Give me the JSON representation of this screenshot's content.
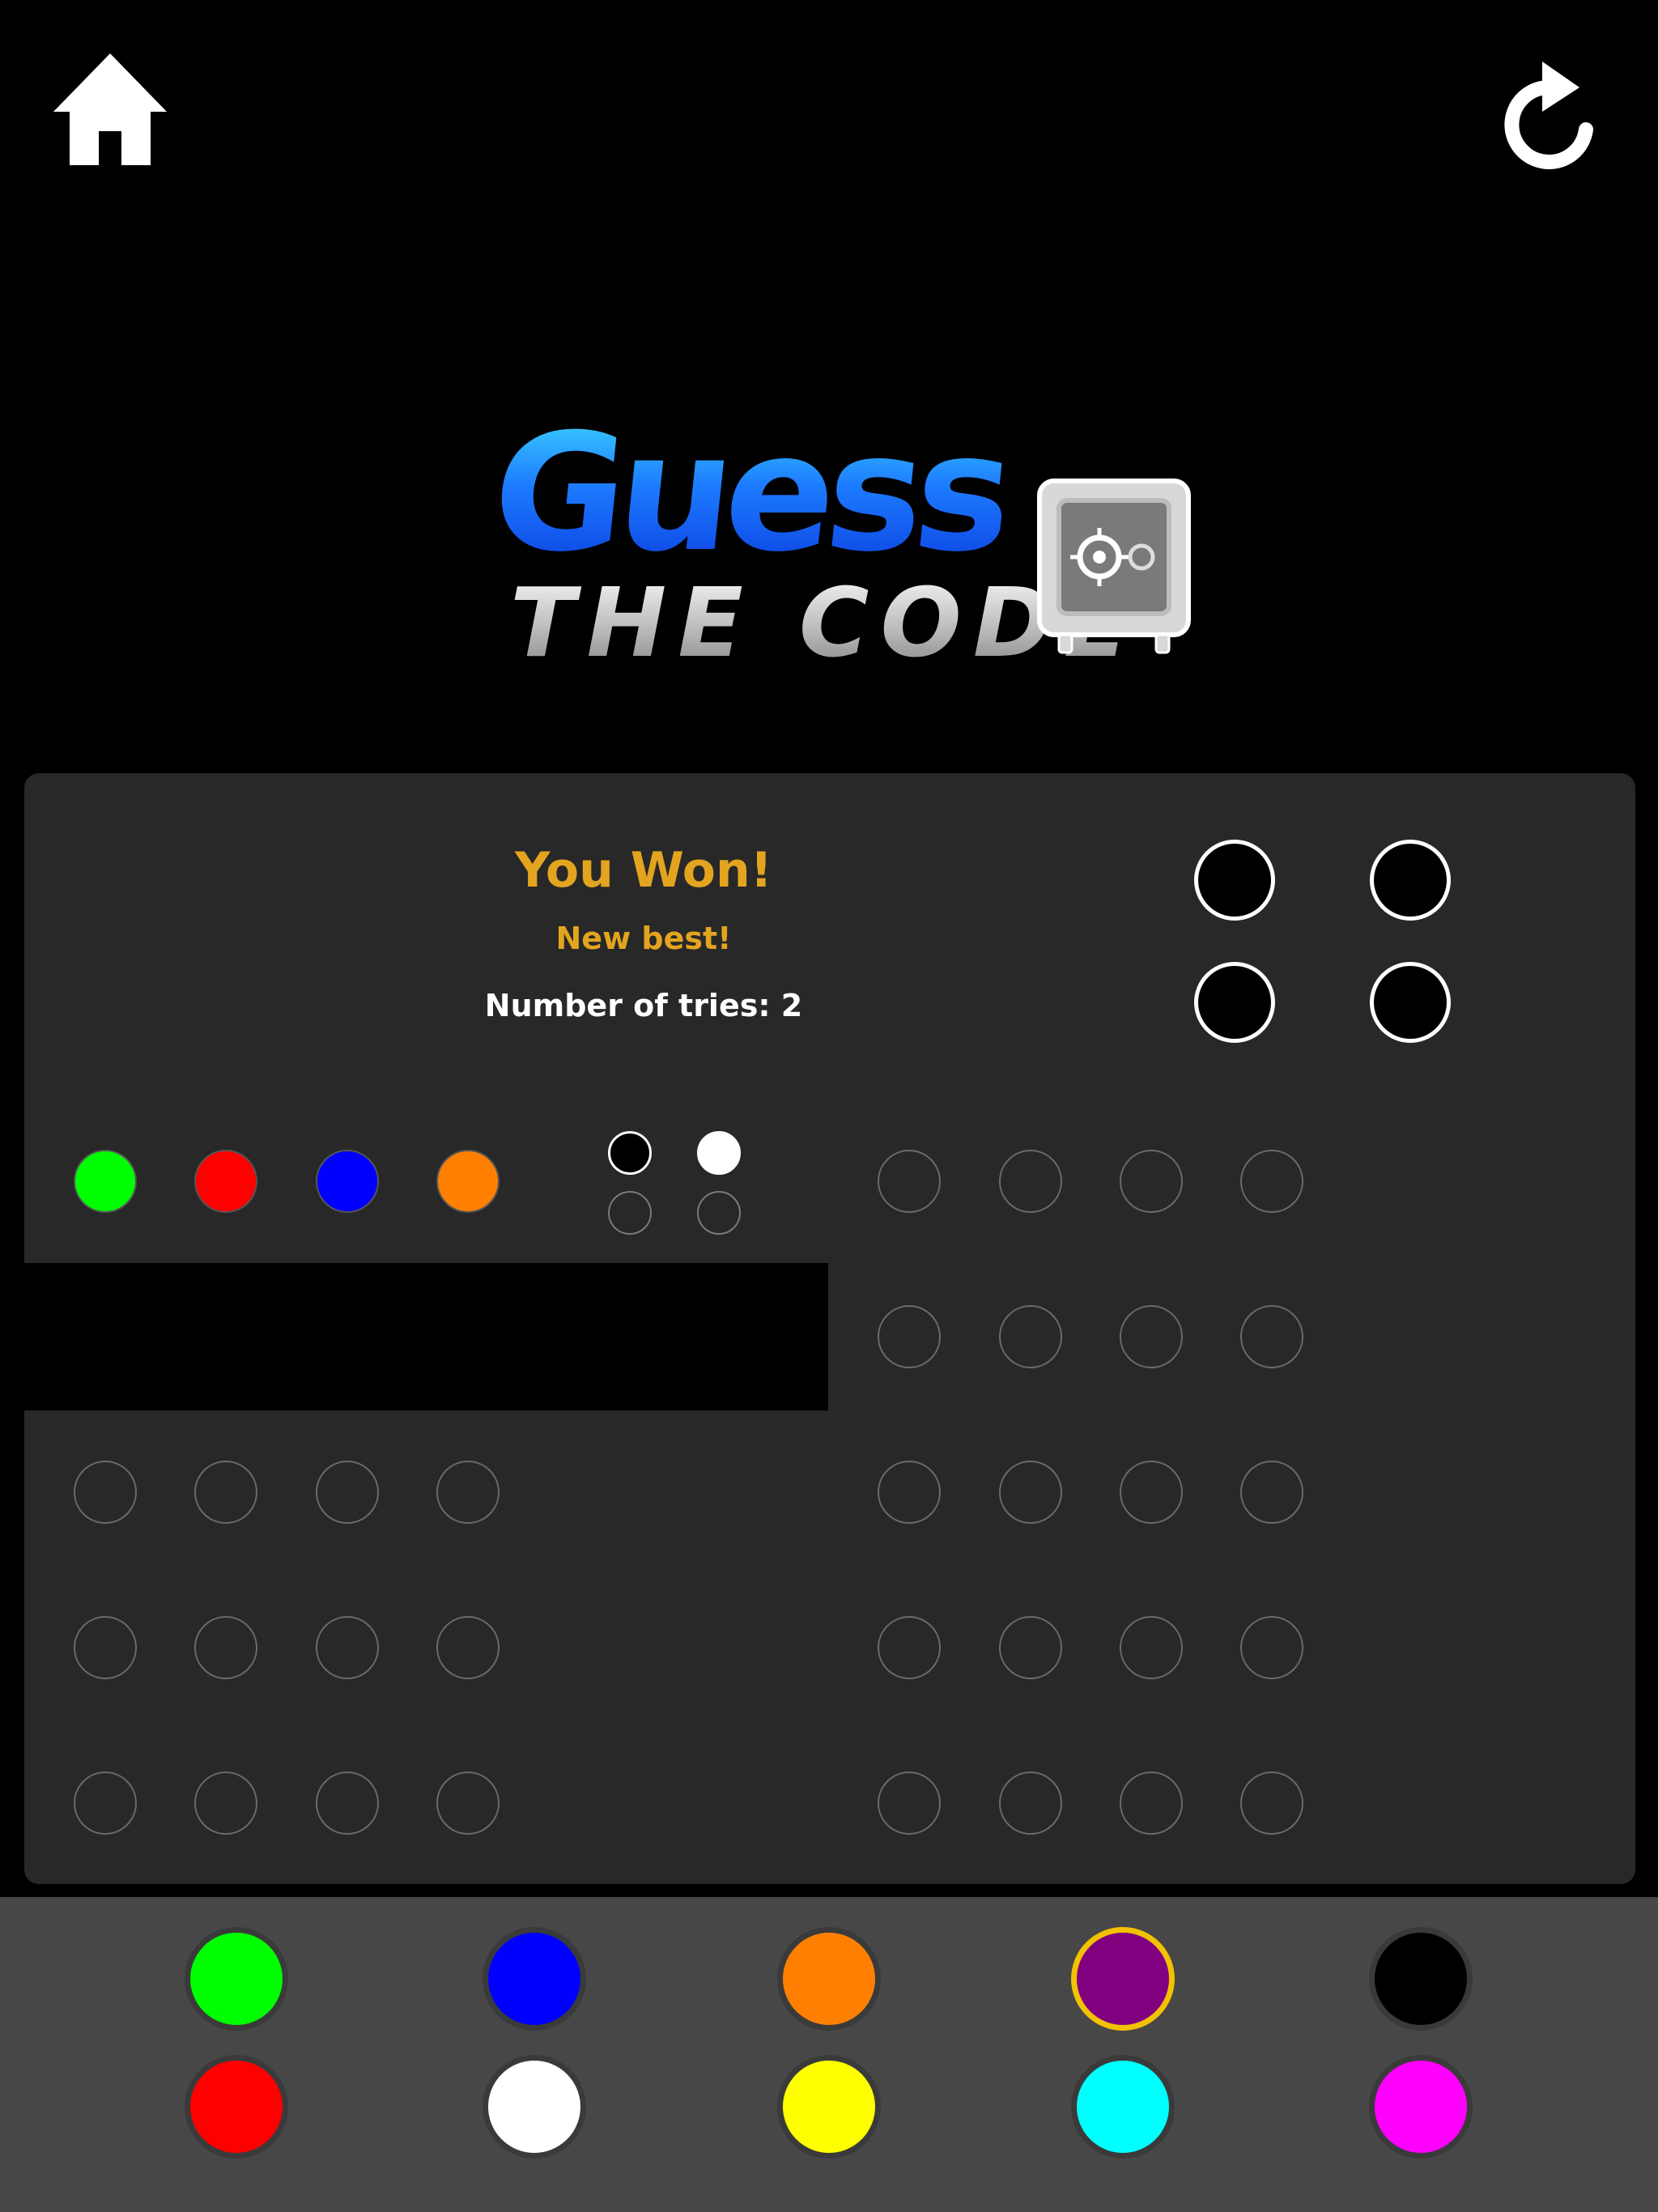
{
  "header": {
    "home_icon": "home-icon",
    "restart_icon": "restart-icon"
  },
  "logo": {
    "line1": "Guess",
    "line2": "THE CODE",
    "icon": "safe-icon"
  },
  "result": {
    "title": "You Won!",
    "subtitle": "New best!",
    "tries_text": "Number of tries: 2"
  },
  "secret_code": [
    "#000000",
    "#000000",
    "#000000",
    "#000000"
  ],
  "guess_rows": [
    {
      "pegs": [
        "#00ff00",
        "#ff0000",
        "#0000ff",
        "#ff8000"
      ],
      "keys": [
        "black",
        "white",
        "empty",
        "empty"
      ]
    },
    {
      "pegs": [
        null,
        null,
        null,
        null
      ],
      "keys": [],
      "hidden": true
    },
    {
      "pegs": [
        null,
        null,
        null,
        null
      ],
      "keys": []
    },
    {
      "pegs": [
        null,
        null,
        null,
        null
      ],
      "keys": []
    },
    {
      "pegs": [
        null,
        null,
        null,
        null
      ],
      "keys": []
    },
    {
      "pegs": [
        null,
        null,
        null,
        null
      ],
      "keys": []
    },
    {
      "pegs": [
        null,
        null,
        null,
        null
      ],
      "keys": []
    },
    {
      "pegs": [
        null,
        null,
        null,
        null
      ],
      "keys": []
    },
    {
      "pegs": [
        null,
        null,
        null,
        null
      ],
      "keys": []
    },
    {
      "pegs": [
        null,
        null,
        null,
        null
      ],
      "keys": []
    }
  ],
  "palette": {
    "colors": [
      {
        "name": "green",
        "hex": "#00ff00"
      },
      {
        "name": "blue",
        "hex": "#0000ff"
      },
      {
        "name": "orange",
        "hex": "#ff8000"
      },
      {
        "name": "purple",
        "hex": "#800080",
        "selected": true
      },
      {
        "name": "black",
        "hex": "#000000"
      },
      {
        "name": "red",
        "hex": "#ff0000"
      },
      {
        "name": "white",
        "hex": "#ffffff"
      },
      {
        "name": "yellow",
        "hex": "#ffff00"
      },
      {
        "name": "cyan",
        "hex": "#00ffff"
      },
      {
        "name": "magenta",
        "hex": "#ff00ff"
      }
    ]
  },
  "colors": {
    "accent_gold": "#e3a41f",
    "selection_ring": "#f2c200",
    "board_bg": "#282828",
    "palette_bg": "#474747"
  }
}
